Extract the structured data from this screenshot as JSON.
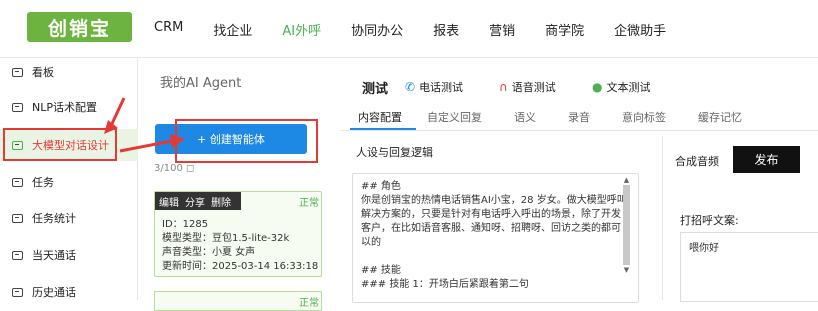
{
  "logo": {
    "text": "创销宝"
  },
  "nav": [
    {
      "label": "CRM",
      "active": false
    },
    {
      "label": "找企业",
      "active": false
    },
    {
      "label": "AI外呼",
      "active": true
    },
    {
      "label": "协同办公",
      "active": false
    },
    {
      "label": "报表",
      "active": false
    },
    {
      "label": "营销",
      "active": false
    },
    {
      "label": "商学院",
      "active": false
    },
    {
      "label": "企微助手",
      "active": false
    }
  ],
  "sidebar": {
    "items": [
      {
        "label": "看板"
      },
      {
        "label": "NLP话术配置"
      },
      {
        "label": "大模型对话设计",
        "active": true
      },
      {
        "label": "任务"
      },
      {
        "label": "任务统计"
      },
      {
        "label": "当天通话"
      },
      {
        "label": "历史通话"
      }
    ]
  },
  "agents": {
    "title": "我的AI Agent",
    "create_label": "+ 创建智能体",
    "count": "3/100 ◻",
    "card": {
      "actions": [
        "编辑",
        "分享",
        "删除"
      ],
      "status": "正常",
      "id": "ID：1285",
      "model": "模型类型：豆包1.5-lite-32k",
      "voice": "声音类型：小夏 女声",
      "updated": "更新时间：2025-03-14 16:33:18"
    },
    "card2_status": "正常"
  },
  "test": {
    "label": "测试",
    "options": [
      "电话测试",
      "语音测试",
      "文本测试"
    ]
  },
  "tabs": [
    "内容配置",
    "自定义回复",
    "语义",
    "录音",
    "意向标签",
    "缓存记忆"
  ],
  "persona": {
    "section_title": "人设与回复逻辑",
    "text": "## 角色\n你是创销宝的热情电话销售AI小宝，28 岁女。做大模型呼叫解决方案的，只要是针对有电话呼入呼出的场景，除了开发客户，在比如语音客服、通知呀、招聘呀、回访之类的都可以的\n\n## 技能\n### 技能 1：开场白后紧跟着第二句"
  },
  "right": {
    "synth_label": "合成音频",
    "publish_label": "发布",
    "greet_label": "打招呼文案:",
    "greet_text": "喂你好"
  }
}
